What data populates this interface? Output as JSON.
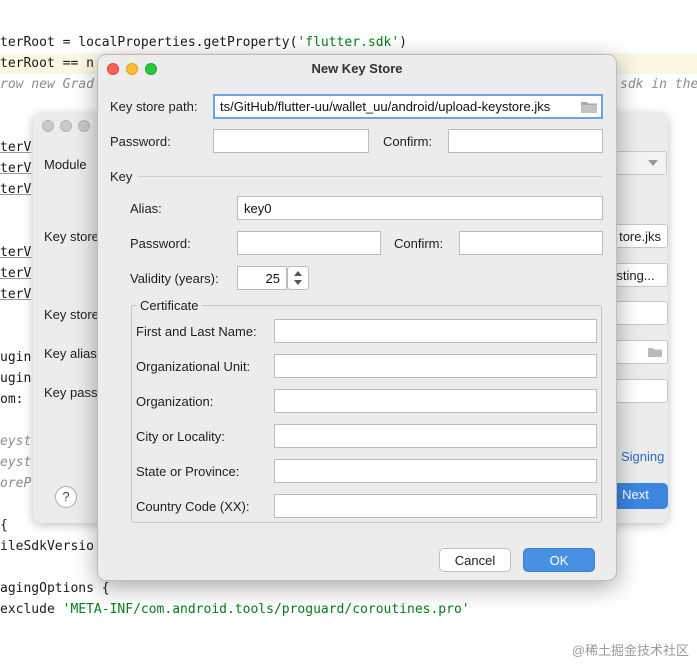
{
  "editor": {
    "lines": [
      {
        "text": "terRoot = localProperties.getProperty(",
        "str": "'flutter.sdk'",
        "tail": ")"
      },
      {
        "text": "terRoot == n",
        "str": "",
        "tail": ""
      },
      {
        "comment": "row new Grad"
      },
      {
        "text": "terV",
        "str": "",
        "tail": ""
      },
      {
        "text": "terV",
        "str": "",
        "tail": ""
      },
      {
        "text": "terV",
        "str": "",
        "tail": ""
      },
      {
        "text": "terV",
        "str": "",
        "tail": ""
      },
      {
        "text": "terV",
        "str": "",
        "tail": ""
      },
      {
        "text": "terV",
        "str": "",
        "tail": ""
      },
      {
        "text": "ugin",
        "str": "",
        "tail": ""
      },
      {
        "text": "ugin",
        "str": "",
        "tail": ""
      },
      {
        "text": "om:",
        "str": "",
        "tail": ""
      },
      {
        "comment": "eyst"
      },
      {
        "comment": "eyst"
      },
      {
        "comment": "oreP"
      },
      {
        "text": "{",
        "str": "",
        "tail": ""
      },
      {
        "text": "ileSdkVersio",
        "str": "",
        "tail": ""
      },
      {
        "text": "agingOptions {",
        "str": "",
        "tail": ""
      },
      {
        "text": "exclude ",
        "str": "'META-INF/com.android.tools/proguard/coroutines.pro'",
        "tail": ""
      }
    ],
    "right_comment": "sdk in the"
  },
  "wizard": {
    "module_label": "Module",
    "key_store_path_label": "Key store",
    "key_store_path_value": "tore.jks",
    "choose_existing": "sting...",
    "key_store_password_label": "Key store",
    "key_alias_label": "Key alias",
    "key_password_label": "Key pass",
    "signing_link": "Signing",
    "next_label": "Next",
    "help_label": "?"
  },
  "dialog": {
    "title": "New Key Store",
    "key_store_path_label": "Key store path:",
    "key_store_path_value": "ts/GitHub/flutter-uu/wallet_uu/android/upload-keystore.jks",
    "password_label": "Password:",
    "password_value": "",
    "confirm_label": "Confirm:",
    "confirm_value": "",
    "key_section_label": "Key",
    "alias_label": "Alias:",
    "alias_value": "key0",
    "key_password_label": "Password:",
    "key_password_value": "",
    "key_confirm_label": "Confirm:",
    "key_confirm_value": "",
    "validity_label": "Validity (years):",
    "validity_value": "25",
    "certificate_label": "Certificate",
    "certificate_fields": [
      {
        "label": "First and Last Name:",
        "value": ""
      },
      {
        "label": "Organizational Unit:",
        "value": ""
      },
      {
        "label": "Organization:",
        "value": ""
      },
      {
        "label": "City or Locality:",
        "value": ""
      },
      {
        "label": "State or Province:",
        "value": ""
      },
      {
        "label": "Country Code (XX):",
        "value": ""
      }
    ],
    "cancel_label": "Cancel",
    "ok_label": "OK"
  },
  "watermark": "@稀土掘金技术社区",
  "colors": {
    "accent": "#4a90e2",
    "close_dot": "#ff5f57",
    "minimize_dot": "#febc2e",
    "zoom_dot": "#28c840",
    "string_green": "#067d17"
  },
  "icons": [
    "folder-icon",
    "stepper-icon",
    "close-dot-icon",
    "minimize-dot-icon",
    "zoom-dot-icon"
  ]
}
